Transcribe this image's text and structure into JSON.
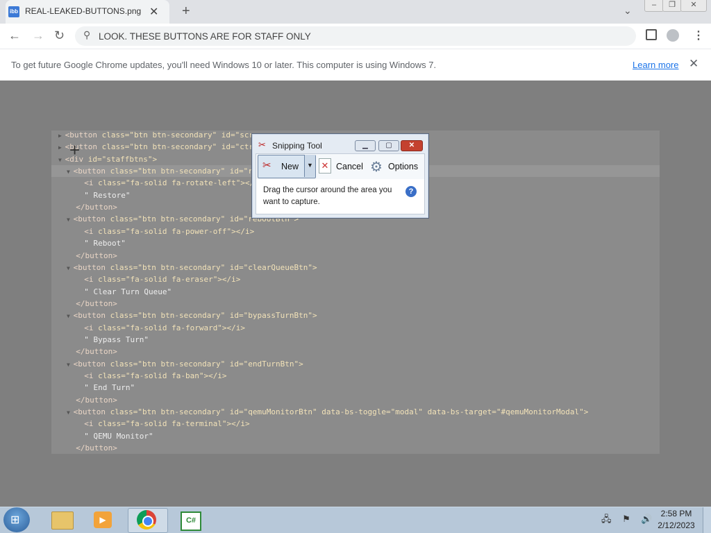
{
  "browser": {
    "tab_title": "REAL-LEAKED-BUTTONS.png (8",
    "tab_favicon_text": "ibb",
    "omnibox_text": "LOOK. THESE BUTTONS ARE FOR STAFF ONLY",
    "infobar": {
      "message": "To get future Google Chrome updates, you'll need Windows 10 or later. This computer is using Windows 7.",
      "learn_more": "Learn more"
    }
  },
  "code_lines": [
    {
      "indent": 1,
      "arrow": "▶",
      "tag": "<button ",
      "attrs": "class=\"btn btn-secondary\" id=\"scr",
      "rest": ""
    },
    {
      "indent": 1,
      "arrow": "▶",
      "tag": "<button ",
      "attrs": "class=\"btn btn-secondary\" id=\"ctr",
      "rest": ""
    },
    {
      "indent": 0,
      "arrow": "▼",
      "tag": "<div ",
      "attrs": "id=\"staffbtns\">",
      "rest": ""
    },
    {
      "indent": 2,
      "arrow": "▼",
      "tag": "<button ",
      "attrs": "class=\"btn btn-secondary\" id=\"r",
      "rest": ""
    },
    {
      "indent": 3,
      "arrow": "",
      "tag": "<i ",
      "attrs": "class=\"fa-solid fa-rotate-left\"></",
      "rest": ""
    },
    {
      "indent": 3,
      "arrow": "",
      "tag": "",
      "attrs": "",
      "rest": "\" Restore\""
    },
    {
      "indent": 2,
      "arrow": "",
      "tag": "</button>",
      "attrs": "",
      "rest": ""
    },
    {
      "indent": 2,
      "arrow": "▼",
      "tag": "<button ",
      "attrs": "class=\"btn btn-secondary\" id=\"rebootBtn\">",
      "rest": ""
    },
    {
      "indent": 3,
      "arrow": "",
      "tag": "<i ",
      "attrs": "class=\"fa-solid fa-power-off\"></i>",
      "rest": ""
    },
    {
      "indent": 3,
      "arrow": "",
      "tag": "",
      "attrs": "",
      "rest": "\" Reboot\""
    },
    {
      "indent": 2,
      "arrow": "",
      "tag": "</button>",
      "attrs": "",
      "rest": ""
    },
    {
      "indent": 2,
      "arrow": "▼",
      "tag": "<button ",
      "attrs": "class=\"btn btn-secondary\" id=\"clearQueueBtn\">",
      "rest": ""
    },
    {
      "indent": 3,
      "arrow": "",
      "tag": "<i ",
      "attrs": "class=\"fa-solid fa-eraser\"></i>",
      "rest": ""
    },
    {
      "indent": 3,
      "arrow": "",
      "tag": "",
      "attrs": "",
      "rest": "\" Clear Turn Queue\""
    },
    {
      "indent": 2,
      "arrow": "",
      "tag": "</button>",
      "attrs": "",
      "rest": ""
    },
    {
      "indent": 2,
      "arrow": "▼",
      "tag": "<button ",
      "attrs": "class=\"btn btn-secondary\" id=\"bypassTurnBtn\">",
      "rest": ""
    },
    {
      "indent": 3,
      "arrow": "",
      "tag": "<i ",
      "attrs": "class=\"fa-solid fa-forward\"></i>",
      "rest": ""
    },
    {
      "indent": 3,
      "arrow": "",
      "tag": "",
      "attrs": "",
      "rest": "\" Bypass Turn\""
    },
    {
      "indent": 2,
      "arrow": "",
      "tag": "</button>",
      "attrs": "",
      "rest": ""
    },
    {
      "indent": 2,
      "arrow": "▼",
      "tag": "<button ",
      "attrs": "class=\"btn btn-secondary\" id=\"endTurnBtn\">",
      "rest": ""
    },
    {
      "indent": 3,
      "arrow": "",
      "tag": "<i ",
      "attrs": "class=\"fa-solid fa-ban\"></i>",
      "rest": ""
    },
    {
      "indent": 3,
      "arrow": "",
      "tag": "",
      "attrs": "",
      "rest": "\" End Turn\""
    },
    {
      "indent": 2,
      "arrow": "",
      "tag": "</button>",
      "attrs": "",
      "rest": ""
    },
    {
      "indent": 2,
      "arrow": "▼",
      "tag": "<button ",
      "attrs": "class=\"btn btn-secondary\" id=\"qemuMonitorBtn\" data-bs-toggle=\"modal\" data-bs-target=\"#qemuMonitorModal\">",
      "rest": ""
    },
    {
      "indent": 3,
      "arrow": "",
      "tag": "<i ",
      "attrs": "class=\"fa-solid fa-terminal\"></i>",
      "rest": ""
    },
    {
      "indent": 3,
      "arrow": "",
      "tag": "",
      "attrs": "",
      "rest": "\" QEMU Monitor\""
    },
    {
      "indent": 2,
      "arrow": "",
      "tag": "</button>",
      "attrs": "",
      "rest": ""
    }
  ],
  "snipping_tool": {
    "title": "Snipping Tool",
    "new_label": "New",
    "cancel_label": "Cancel",
    "options_label": "Options",
    "message": "Drag the cursor around the area you want to capture.",
    "help": "?"
  },
  "taskbar": {
    "time": "2:58 PM",
    "date": "2/12/2023",
    "cs_label": "C#"
  }
}
